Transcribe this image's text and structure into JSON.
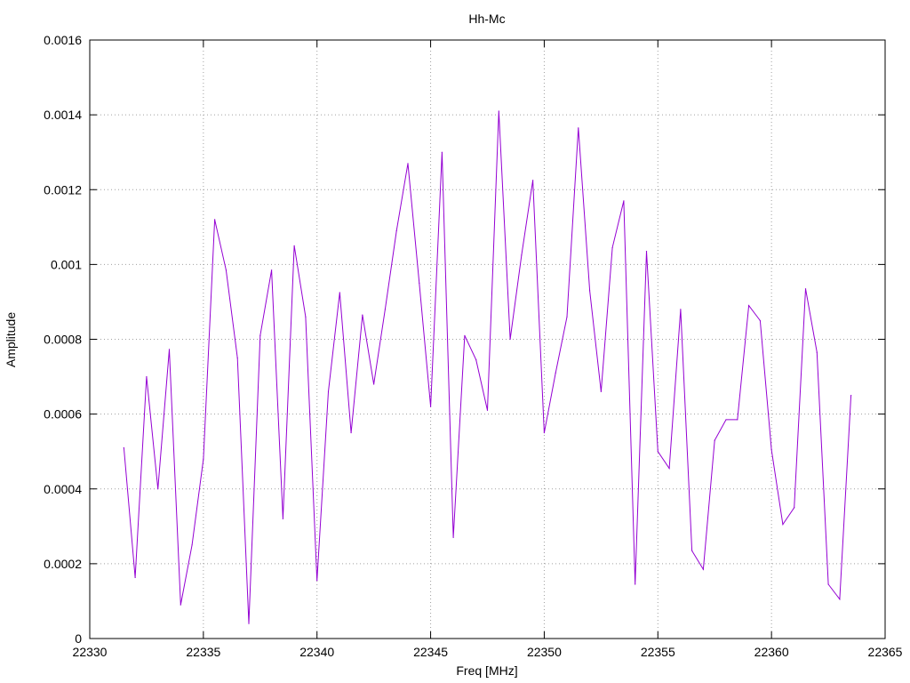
{
  "chart_data": {
    "type": "line",
    "title": "Hh-Mc",
    "xlabel": "Freq [MHz]",
    "ylabel": "Amplitude",
    "xlim": [
      22330,
      22365
    ],
    "ylim": [
      0,
      0.0016
    ],
    "x_ticks": [
      "22330",
      "22335",
      "22340",
      "22345",
      "22350",
      "22355",
      "22360",
      "22365"
    ],
    "y_ticks": [
      "0",
      "0.0002",
      "0.0004",
      "0.0006",
      "0.0008",
      "0.001",
      "0.0012",
      "0.0014",
      "0.0016"
    ],
    "grid": true,
    "series": [
      {
        "color": "#9400d3",
        "x": [
          22331.5,
          22332,
          22332.5,
          22333,
          22333.5,
          22334,
          22334.5,
          22335,
          22335.5,
          22336,
          22336.5,
          22337,
          22337.5,
          22338,
          22338.5,
          22339,
          22339.5,
          22340,
          22340.5,
          22341,
          22341.5,
          22342,
          22342.5,
          22343,
          22343.5,
          22344,
          22344.5,
          22345,
          22345.5,
          22346,
          22346.5,
          22347,
          22347.5,
          22348,
          22348.5,
          22349,
          22349.5,
          22350,
          22350.5,
          22351,
          22351.5,
          22352,
          22352.5,
          22353,
          22353.5,
          22354,
          22354.5,
          22355,
          22355.5,
          22356,
          22356.5,
          22357,
          22357.5,
          22358,
          22358.5,
          22359,
          22359.5,
          22360,
          22360.5,
          22361,
          22361.5,
          22362,
          22362.5,
          22363,
          22363.5
        ],
        "y": [
          0.00051,
          0.000163,
          0.0007,
          0.0004,
          0.000773,
          9e-05,
          0.00025,
          0.00048,
          0.00112,
          0.000985,
          0.00075,
          4e-05,
          0.00081,
          0.000985,
          0.00032,
          0.00105,
          0.00086,
          0.000155,
          0.00066,
          0.000925,
          0.00055,
          0.000865,
          0.00068,
          0.00088,
          0.00109,
          0.00127,
          0.00095,
          0.00062,
          0.0013,
          0.00027,
          0.00081,
          0.000745,
          0.00061,
          0.00141,
          0.0008,
          0.001025,
          0.001225,
          0.00055,
          0.00071,
          0.00086,
          0.001365,
          0.00093,
          0.00066,
          0.001045,
          0.00117,
          0.000145,
          0.001035,
          0.0005,
          0.000455,
          0.00088,
          0.000235,
          0.000185,
          0.00053,
          0.000585,
          0.000585,
          0.00089,
          0.00085,
          0.000505,
          0.000305,
          0.00035,
          0.000935,
          0.000765,
          0.000145,
          0.000105,
          0.00065
        ]
      }
    ]
  }
}
